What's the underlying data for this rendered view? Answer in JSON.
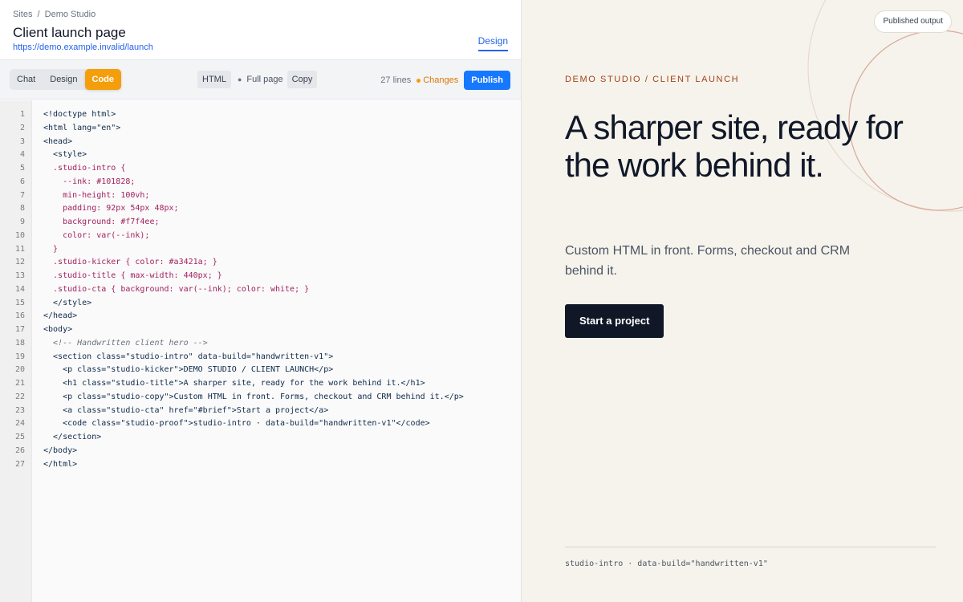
{
  "editor": {
    "breadcrumb": {
      "sites": "Sites",
      "separator": "/",
      "project": "Demo Studio"
    },
    "title": "Client launch page",
    "url": "https://demo.example.invalid/launch",
    "design_tab": "Design",
    "mode_tabs": [
      {
        "label": "Chat",
        "active": false
      },
      {
        "label": "Design",
        "active": false
      },
      {
        "label": "Code",
        "active": true
      }
    ],
    "format_label": "HTML",
    "scope_label": "Full page",
    "copy_label": "Copy",
    "line_count": "27 lines",
    "changes_label": "Changes",
    "publish_label": "Publish",
    "code_lines": [
      "<!doctype html>",
      "<html lang=\"en\">",
      "<head>",
      "  <style>",
      "  .studio-intro {",
      "    --ink: #101828;",
      "    min-height: 100vh;",
      "    padding: 92px 54px 48px;",
      "    background: #f7f4ee;",
      "    color: var(--ink);",
      "  }",
      "  .studio-kicker { color: #a3421a; }",
      "  .studio-title { max-width: 440px; }",
      "  .studio-cta { background: var(--ink); color: white; }",
      "  </style>",
      "</head>",
      "<body>",
      "  <!-- Handwritten client hero -->",
      "  <section class=\"studio-intro\" data-build=\"handwritten-v1\">",
      "    <p class=\"studio-kicker\">DEMO STUDIO / CLIENT LAUNCH</p>",
      "    <h1 class=\"studio-title\">A sharper site, ready for the work behind it.</h1>",
      "    <p class=\"studio-copy\">Custom HTML in front. Forms, checkout and CRM behind it.</p>",
      "    <a class=\"studio-cta\" href=\"#brief\">Start a project</a>",
      "    <code class=\"studio-proof\">studio-intro · data-build=\"handwritten-v1\"</code>",
      "  </section>",
      "</body>",
      "</html>"
    ]
  },
  "preview": {
    "published_badge": "Published output",
    "kicker": "DEMO STUDIO / CLIENT LAUNCH",
    "title": "A sharper site, ready for the work behind it.",
    "copy": "Custom HTML in front. Forms, checkout and CRM behind it.",
    "cta": "Start a project",
    "proof": "studio-intro · data-build=\"handwritten-v1\""
  },
  "colors": {
    "accent_blue": "#1677ff",
    "code_active_orange": "#f59e0b",
    "preview_bg": "#f6f3ec",
    "ink": "#101828",
    "kicker": "#a3421a"
  }
}
